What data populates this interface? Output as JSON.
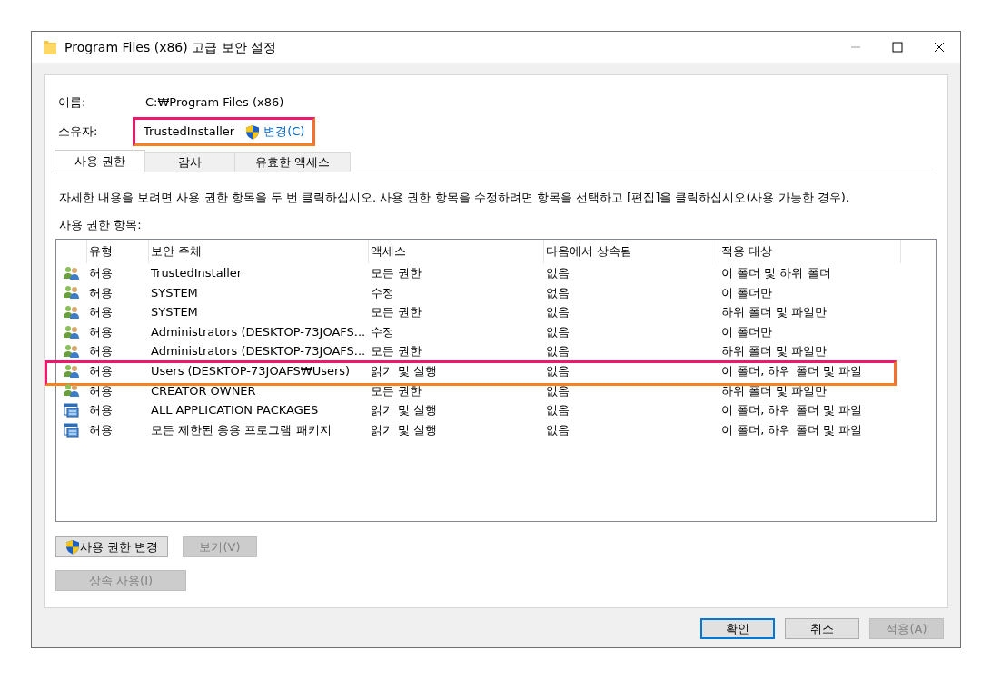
{
  "window": {
    "title": "Program Files (x86) 고급 보안 설정"
  },
  "name": {
    "label": "이름:",
    "value": "C:₩Program Files (x86)"
  },
  "owner": {
    "label": "소유자:",
    "value": "TrustedInstaller",
    "change_link": "변경(C)",
    "highlighted": true
  },
  "tabs": [
    {
      "label": "사용 권한",
      "selected": true
    },
    {
      "label": "감사",
      "selected": false
    },
    {
      "label": "유효한 액세스",
      "selected": false
    }
  ],
  "description": "자세한 내용을 보려면 사용 권한 항목을 두 번 클릭하십시오. 사용 권한 항목을 수정하려면 항목을 선택하고 [편집]을 클릭하십시오(사용 가능한 경우).",
  "entries_label": "사용 권한 항목:",
  "permissions": {
    "columns": [
      "유형",
      "보안 주체",
      "액세스",
      "다음에서 상속됨",
      "적용 대상"
    ],
    "rows": [
      {
        "kind": "user",
        "type": "허용",
        "principal": "TrustedInstaller",
        "access": "모든 권한",
        "inherited_from": "없음",
        "applies_to": "이 폴더 및 하위 폴더",
        "highlighted": false
      },
      {
        "kind": "user",
        "type": "허용",
        "principal": "SYSTEM",
        "access": "수정",
        "inherited_from": "없음",
        "applies_to": "이 폴더만",
        "highlighted": false
      },
      {
        "kind": "user",
        "type": "허용",
        "principal": "SYSTEM",
        "access": "모든 권한",
        "inherited_from": "없음",
        "applies_to": "하위 폴더 및 파일만",
        "highlighted": false
      },
      {
        "kind": "user",
        "type": "허용",
        "principal": "Administrators (DESKTOP-73JOAFS...",
        "access": "수정",
        "inherited_from": "없음",
        "applies_to": "이 폴더만",
        "highlighted": false
      },
      {
        "kind": "user",
        "type": "허용",
        "principal": "Administrators (DESKTOP-73JOAFS...",
        "access": "모든 권한",
        "inherited_from": "없음",
        "applies_to": "하위 폴더 및 파일만",
        "highlighted": false
      },
      {
        "kind": "user",
        "type": "허용",
        "principal": "Users (DESKTOP-73JOAFS₩Users)",
        "access": "읽기 및 실행",
        "inherited_from": "없음",
        "applies_to": "이 폴더, 하위 폴더 및 파일",
        "highlighted": true
      },
      {
        "kind": "user",
        "type": "허용",
        "principal": "CREATOR OWNER",
        "access": "모든 권한",
        "inherited_from": "없음",
        "applies_to": "하위 폴더 및 파일만",
        "highlighted": false
      },
      {
        "kind": "package",
        "type": "허용",
        "principal": "ALL APPLICATION PACKAGES",
        "access": "읽기 및 실행",
        "inherited_from": "없음",
        "applies_to": "이 폴더, 하위 폴더 및 파일",
        "highlighted": false
      },
      {
        "kind": "package",
        "type": "허용",
        "principal": "모든 제한된 응용 프로그램 패키지",
        "access": "읽기 및 실행",
        "inherited_from": "없음",
        "applies_to": "이 폴더, 하위 폴더 및 파일",
        "highlighted": false
      }
    ]
  },
  "buttons": [
    {
      "label": "사용 권한 변경",
      "shield": true,
      "disabled": false
    },
    {
      "label": "보기(V)",
      "shield": false,
      "disabled": true
    }
  ],
  "inherit_button": {
    "label": "상속 사용(I)",
    "disabled": true
  },
  "footer_buttons": [
    {
      "label": "확인",
      "default": true,
      "disabled": false
    },
    {
      "label": "취소",
      "default": false,
      "disabled": false
    },
    {
      "label": "적용(A)",
      "default": false,
      "disabled": true
    }
  ]
}
